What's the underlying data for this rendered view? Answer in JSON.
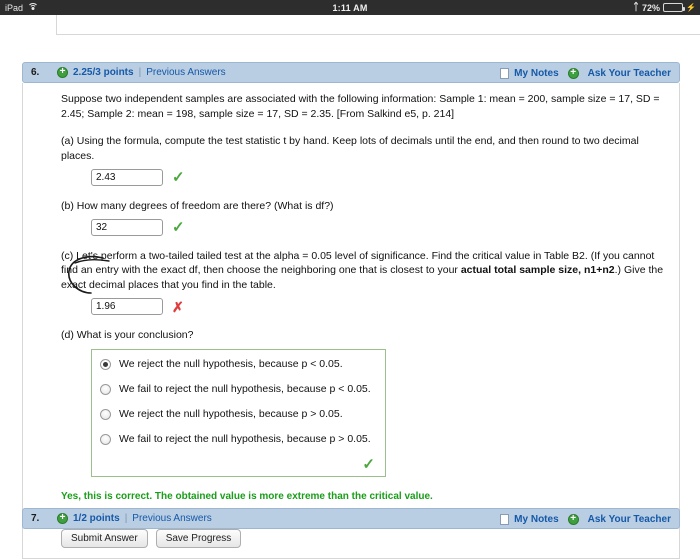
{
  "statusbar": {
    "device": "iPad",
    "wifi_icon": "wifi-icon",
    "time": "1:11 AM",
    "bluetooth_icon": "bluetooth-icon",
    "battery_percent": "72%",
    "battery_icon": "battery-icon",
    "battery_fill_color": "#4cd35f",
    "charging_icon": "plug-icon"
  },
  "questions": [
    {
      "number": "6.",
      "status_icon": "plus-circle-icon",
      "points": "2.25/3 points",
      "separator": "|",
      "previous_answers": "Previous Answers",
      "my_notes": "My Notes",
      "my_notes_icon": "note-icon",
      "ask_teacher": "Ask Your Teacher",
      "ask_teacher_icon": "plus-circle-icon"
    },
    {
      "number": "7.",
      "status_icon": "plus-circle-icon",
      "points": "1/2 points",
      "separator": "|",
      "previous_answers": "Previous Answers",
      "my_notes": "My Notes",
      "my_notes_icon": "note-icon",
      "ask_teacher": "Ask Your Teacher",
      "ask_teacher_icon": "plus-circle-icon"
    }
  ],
  "question6": {
    "intro": "Suppose two independent samples are associated with the following information: Sample 1: mean = 200, sample size = 17, SD = 2.45; Sample 2: mean = 198, sample size = 17, SD = 2.35. [From Salkind e5, p. 214]",
    "part_a": {
      "prompt": "(a) Using the formula, compute the test statistic t by hand. Keep lots of decimals until the end, and then round to two decimal places.",
      "value": "2.43",
      "result_icon": "check-icon",
      "result": "correct"
    },
    "part_b": {
      "prompt": "(b) How many degrees of freedom are there? (What is df?)",
      "value": "32",
      "result_icon": "check-icon",
      "result": "correct"
    },
    "part_c": {
      "prompt_1": "(c) Let's perform a two-tailed tailed test at the alpha = 0.05 level of significance. Find the critical value in Table B2. (If you cannot find an entry with the exact df, then choose the neighboring one that is closest to your ",
      "prompt_bold_1": "actual total sample size, n1+n2",
      "prompt_2": ".) Give the exact decimal places that you find in the table.",
      "value": "1.96",
      "result_icon": "x-icon",
      "result": "incorrect",
      "annotation": "hand-drawn-circle"
    },
    "part_d": {
      "prompt": "(d) What is your conclusion?",
      "choices": [
        {
          "label": "We reject the null hypothesis, because p < 0.05.",
          "selected": true
        },
        {
          "label": "We fail to reject the null hypothesis, because p < 0.05.",
          "selected": false
        },
        {
          "label": "We reject the null hypothesis, because p > 0.05.",
          "selected": false
        },
        {
          "label": "We fail to reject the null hypothesis, because p > 0.05.",
          "selected": false
        }
      ],
      "result_icon": "check-icon",
      "result": "correct"
    },
    "feedback": "Yes, this is correct. The obtained value is more extreme than the critical value.",
    "submit_label": "Submit Answer",
    "save_label": "Save Progress"
  },
  "colors": {
    "header_bar": "#b9cde3",
    "link": "#1559a8",
    "correct_green": "#1a9e1a",
    "incorrect_red": "#e03c3c",
    "choicebox_border": "#9cc08c"
  }
}
